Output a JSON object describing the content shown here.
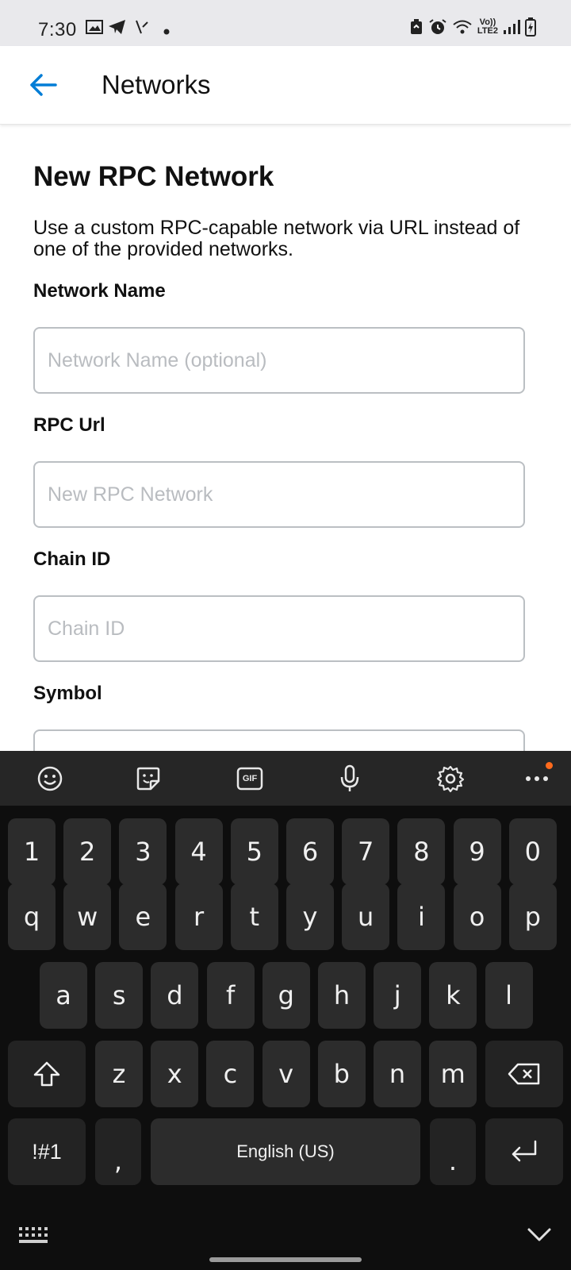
{
  "status_bar": {
    "time": "7:30",
    "network_top": "Vo))",
    "network_bottom": "LTE2"
  },
  "app_bar": {
    "title": "Networks",
    "back_icon": "arrow-left-icon",
    "accent_color": "#037dd6"
  },
  "form": {
    "section_title": "New RPC Network",
    "description": "Use a custom RPC-capable network via URL instead of one of the provided networks.",
    "fields": [
      {
        "label": "Network Name",
        "placeholder": "Network Name (optional)",
        "value": ""
      },
      {
        "label": "RPC Url",
        "placeholder": "New RPC Network",
        "value": ""
      },
      {
        "label": "Chain ID",
        "placeholder": "Chain ID",
        "value": ""
      },
      {
        "label": "Symbol",
        "placeholder": "",
        "value": ""
      }
    ]
  },
  "keyboard": {
    "toolbar_icons": [
      "emoji-icon",
      "sticker-icon",
      "gif-icon",
      "microphone-icon",
      "settings-icon",
      "more-icon"
    ],
    "gif_label": "GIF",
    "rows": {
      "numbers": [
        "1",
        "2",
        "3",
        "4",
        "5",
        "6",
        "7",
        "8",
        "9",
        "0"
      ],
      "row1": [
        "q",
        "w",
        "e",
        "r",
        "t",
        "y",
        "u",
        "i",
        "o",
        "p"
      ],
      "row2": [
        "a",
        "s",
        "d",
        "f",
        "g",
        "h",
        "j",
        "k",
        "l"
      ],
      "row3": [
        "z",
        "x",
        "c",
        "v",
        "b",
        "n",
        "m"
      ]
    },
    "symbols_key": "!#1",
    "comma_key": ",",
    "space_label": "English (US)",
    "period_key": "."
  }
}
